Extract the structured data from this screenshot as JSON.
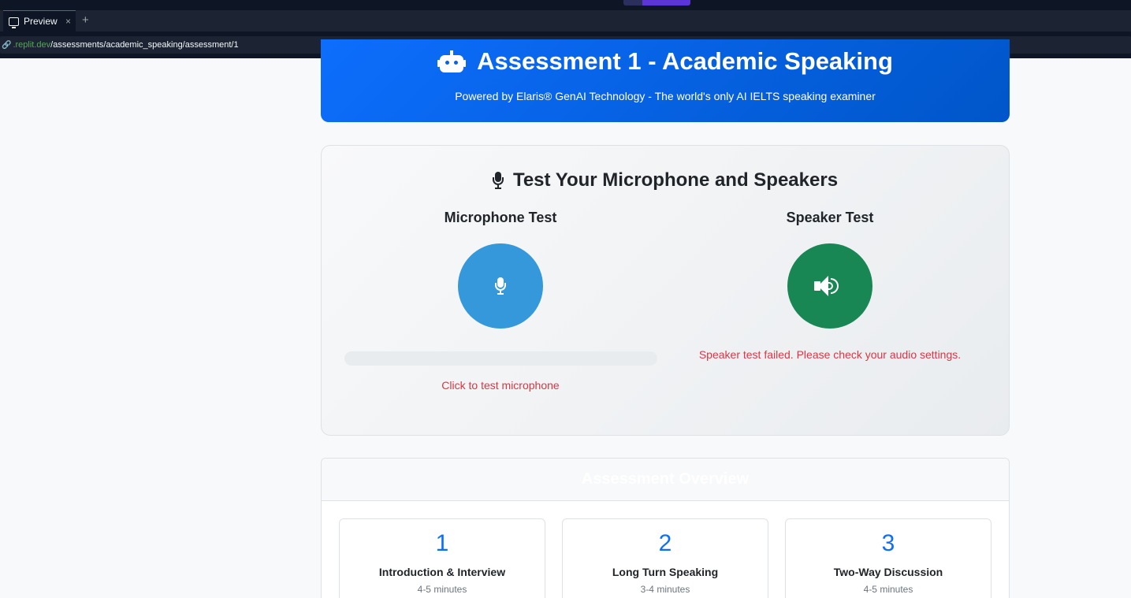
{
  "browser": {
    "tab_label": "Preview",
    "tab_close": "×",
    "new_tab": "+",
    "url_domain": ".replit.dev",
    "url_path": "/assessments/academic_speaking/assessment/1"
  },
  "header": {
    "title": "Assessment 1 - Academic Speaking",
    "subtitle": "Powered by Elaris® GenAI Technology - The world's only AI IELTS speaking examiner"
  },
  "device_test": {
    "title": "Test Your Microphone and Speakers",
    "microphone": {
      "title": "Microphone Test",
      "status": "Click to test microphone",
      "level": 0
    },
    "speaker": {
      "title": "Speaker Test",
      "status": "Speaker test failed. Please check your audio settings."
    }
  },
  "overview": {
    "title": "Assessment Overview",
    "parts": [
      {
        "number": "1",
        "name": "Introduction & Interview",
        "duration": "4-5 minutes"
      },
      {
        "number": "2",
        "name": "Long Turn Speaking",
        "duration": "3-4 minutes"
      },
      {
        "number": "3",
        "name": "Two-Way Discussion",
        "duration": "4-5 minutes"
      }
    ]
  },
  "colors": {
    "primary": "#0d6efd",
    "mic_button": "#3498db",
    "speaker_button": "#198754",
    "error": "#dc3545"
  }
}
